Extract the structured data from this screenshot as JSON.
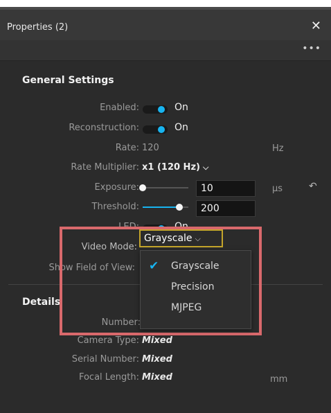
{
  "panel": {
    "title": "Properties (2)",
    "more_label": "•••"
  },
  "general": {
    "heading": "General Settings",
    "enabled": {
      "label": "Enabled:",
      "value": "On"
    },
    "reconstruction": {
      "label": "Reconstruction:",
      "value": "On"
    },
    "rate": {
      "label": "Rate:",
      "value": "120",
      "unit": "Hz"
    },
    "rate_multiplier": {
      "label": "Rate Multiplier:",
      "value": "x1 (120 Hz)"
    },
    "exposure": {
      "label": "Exposure:",
      "value": "10",
      "unit": "µs",
      "slider_fraction": 0.0
    },
    "threshold": {
      "label": "Threshold:",
      "value": "200",
      "slider_fraction": 0.8
    },
    "led": {
      "label": "LED:",
      "value": "On"
    },
    "video_mode": {
      "label": "Video Mode:",
      "value": "Grayscale"
    },
    "show_fov": {
      "label": "Show Field of View:"
    }
  },
  "dropdown": {
    "options": [
      "Grayscale",
      "Precision",
      "MJPEG"
    ],
    "selected": "Grayscale"
  },
  "details": {
    "heading": "Details",
    "number": {
      "label": "Number:"
    },
    "camera_type": {
      "label": "Camera Type:",
      "value": "Mixed"
    },
    "serial_number": {
      "label": "Serial Number:",
      "value": "Mixed"
    },
    "focal_length": {
      "label": "Focal Length:",
      "value": "Mixed",
      "unit": "mm"
    }
  },
  "colors": {
    "accent": "#18b4f0",
    "highlight_box": "#d9696c",
    "select_border": "#c4a52b"
  }
}
